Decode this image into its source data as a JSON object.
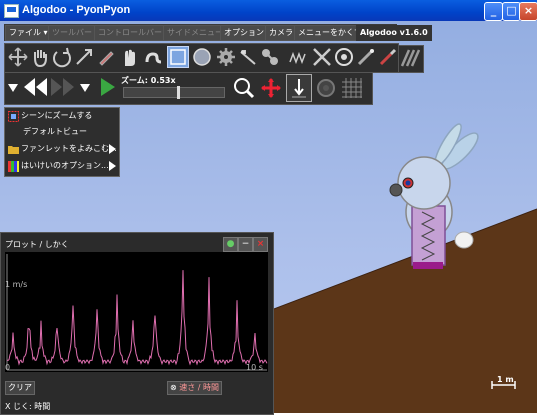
{
  "window": {
    "title": "Algodoo - PyonPyon",
    "minimize_glyph": "_",
    "maximize_glyph": "□",
    "close_glyph": "×"
  },
  "menubar": {
    "file": "ファイル ▾",
    "toolbar": "ツールバー",
    "control_bar": "コントロールバー",
    "side_menu": "サイドメニュー",
    "options": "オプション",
    "camera": "カメラ",
    "hide_menu": "メニューをかくす",
    "version": "Algodoo v1.6.0"
  },
  "toolbar": {
    "icons": [
      "move-icon",
      "hand-icon",
      "rotate-icon",
      "scale-icon",
      "sketch-icon",
      "drag-icon",
      "rope-icon",
      "box-icon",
      "circle-icon",
      "gear-icon",
      "polygon-icon",
      "chain-icon",
      "spring-icon",
      "fixate-icon",
      "axle-icon",
      "thruster-icon",
      "laser-icon",
      "texture-icon"
    ],
    "selected": "box-icon"
  },
  "controlbar": {
    "zoom_label": "ズーム: 0.53x",
    "zoom_level": 0.53
  },
  "popup_menu": {
    "items": [
      {
        "label": "シーンにズームする",
        "icon": "zoom-scene-icon",
        "arrow": false
      },
      {
        "label": "デフォルトビュー",
        "icon": "",
        "arrow": false
      },
      {
        "label": "ファンレットをよみこむ...",
        "icon": "folder-icon",
        "arrow": true
      },
      {
        "label": "はいけいのオプション...",
        "icon": "palette-icon",
        "arrow": true
      }
    ]
  },
  "plot": {
    "title": "プロット / しかく",
    "y_label": "1 m/s",
    "x_start": "0",
    "x_end": "10 s",
    "clear_button": "クリア",
    "y_axis_button": "速さ / 時間",
    "x_axis_note": "X じく: 時間",
    "line_color": "#e06fb0",
    "series_color_name": "pink"
  },
  "scale": {
    "label": "1 m"
  },
  "scene": {
    "sky_color": "#a8bdea",
    "ground_color": "#5c3618"
  }
}
